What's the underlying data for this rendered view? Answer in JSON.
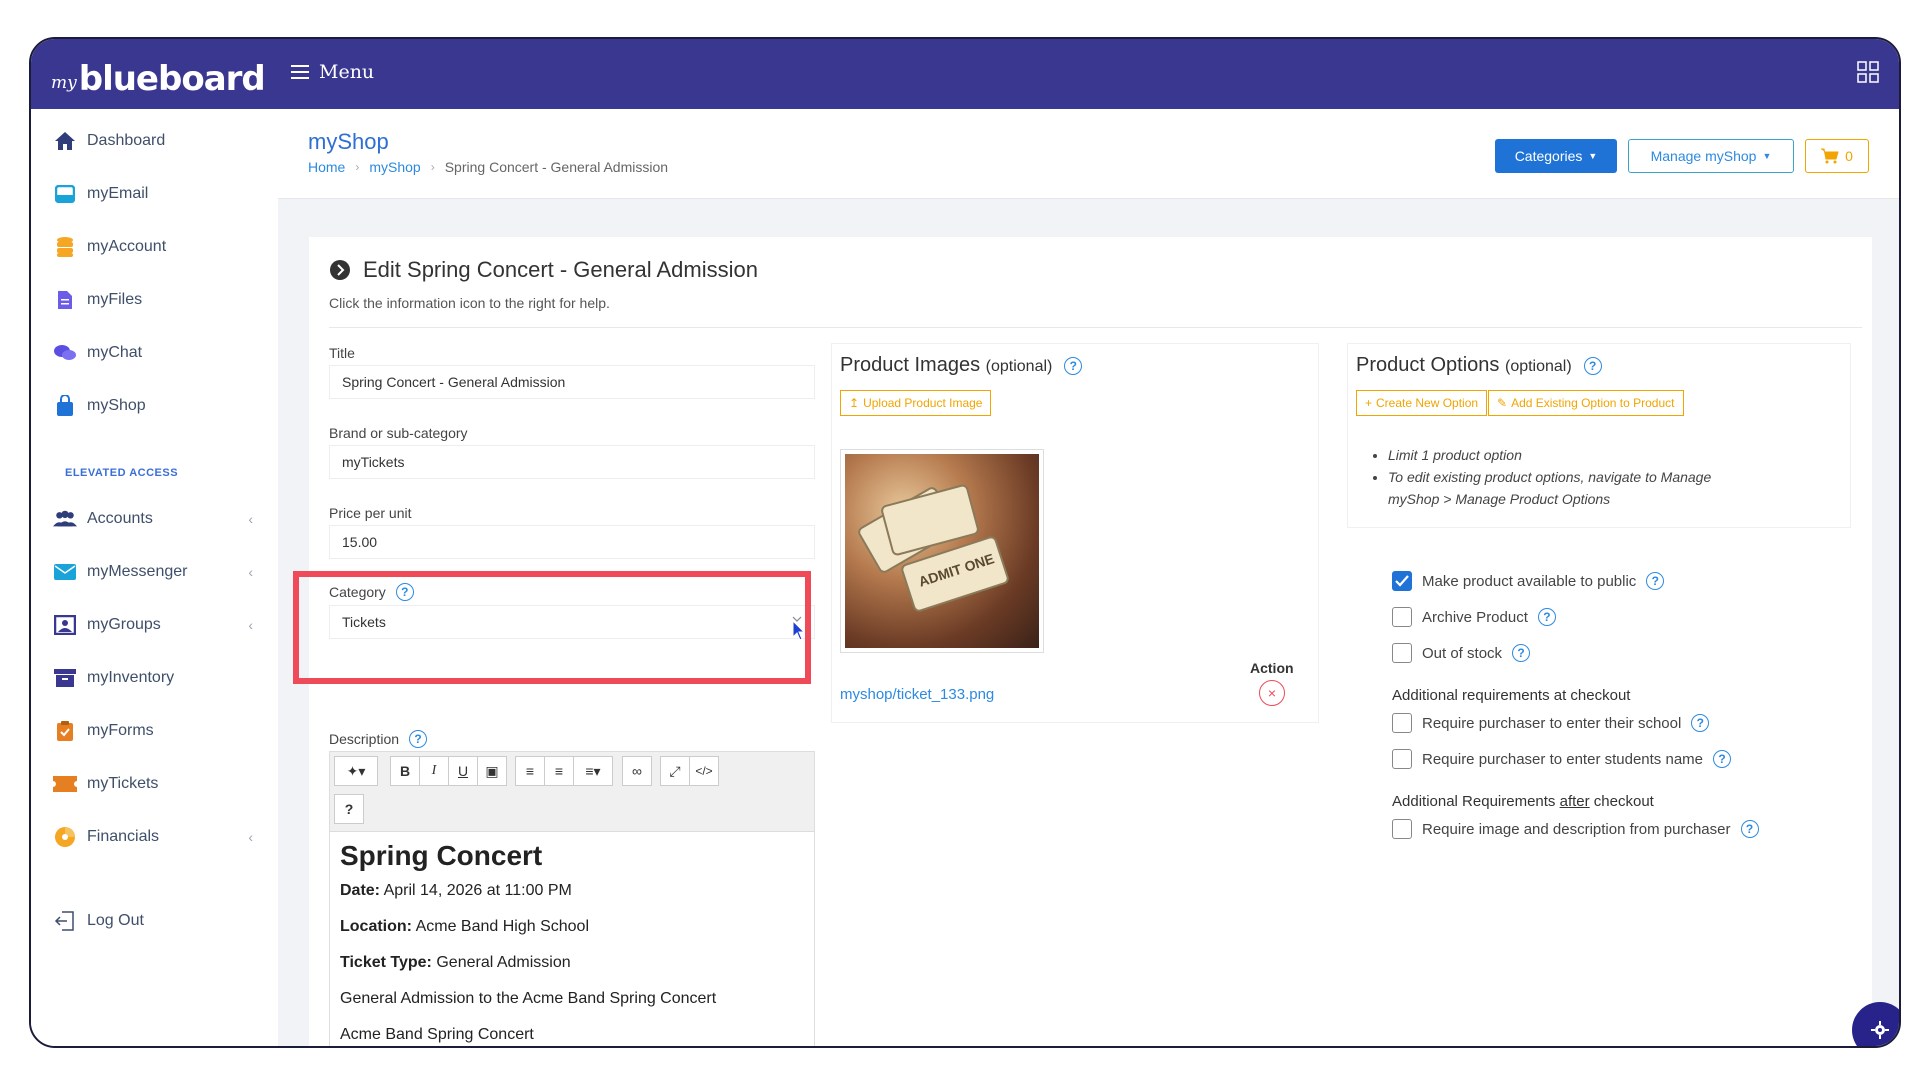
{
  "app": {
    "logo_prefix": "my",
    "logo_main": "blueboard",
    "menu_label": "Menu"
  },
  "sidebar": {
    "items": [
      {
        "label": "Dashboard",
        "icon": "home-icon",
        "color": "#2f3e7a"
      },
      {
        "label": "myEmail",
        "icon": "inbox-icon",
        "color": "#1aa3d9"
      },
      {
        "label": "myAccount",
        "icon": "database-icon",
        "color": "#f5a623"
      },
      {
        "label": "myFiles",
        "icon": "file-icon",
        "color": "#6c5ce7"
      },
      {
        "label": "myChat",
        "icon": "chat-icon",
        "color": "#5b4fe3"
      },
      {
        "label": "myShop",
        "icon": "shopping-bag-icon",
        "color": "#1f73d7"
      }
    ],
    "section_label": "ELEVATED ACCESS",
    "elevated_items": [
      {
        "label": "Accounts",
        "icon": "users-icon",
        "color": "#2f3e7a"
      },
      {
        "label": "myMessenger",
        "icon": "envelope-icon",
        "color": "#1aa3d9"
      },
      {
        "label": "myGroups",
        "icon": "groups-icon",
        "color": "#3a3790"
      },
      {
        "label": "myInventory",
        "icon": "archive-icon",
        "color": "#3a3790"
      },
      {
        "label": "myForms",
        "icon": "clipboard-icon",
        "color": "#e67e22"
      },
      {
        "label": "myTickets",
        "icon": "ticket-icon",
        "color": "#e67e22"
      },
      {
        "label": "Financials",
        "icon": "pie-chart-icon",
        "color": "#f5a623"
      }
    ],
    "logout_label": "Log Out"
  },
  "header": {
    "title": "myShop",
    "breadcrumb": [
      "Home",
      "myShop",
      "Spring Concert - General Admission"
    ],
    "categories_button": "Categories",
    "manage_button": "Manage myShop",
    "cart_count": "0"
  },
  "form": {
    "heading": "Edit Spring Concert - General Admission",
    "subheading": "Click the information icon to the right for help.",
    "title_label": "Title",
    "title_value": "Spring Concert - General Admission",
    "brand_label": "Brand or sub-category",
    "brand_value": "myTickets",
    "price_label": "Price per unit",
    "price_value": "15.00",
    "category_label": "Category",
    "category_value": "Tickets",
    "description_label": "Description",
    "toolbar": {
      "bold": "B",
      "italic": "I",
      "underline": "U",
      "help": "?",
      "code": "</>"
    },
    "description": {
      "heading": "Spring Concert",
      "date_label": "Date:",
      "date_value": "April 14, 2026 at 11:00 PM",
      "location_label": "Location:",
      "location_value": "Acme Band High School",
      "ticket_type_label": "Ticket Type:",
      "ticket_type_value": "General Admission",
      "line1": "General Admission to the Acme Band Spring Concert",
      "line2": "Acme Band Spring Concert"
    }
  },
  "images": {
    "title": "Product Images",
    "optional": "(optional)",
    "upload_button": "Upload Product Image",
    "image_text": "ADMIT ONE",
    "action_label": "Action",
    "file_name": "myshop/ticket_133.png"
  },
  "options": {
    "title": "Product Options",
    "optional": "(optional)",
    "create_button": "Create New Option",
    "add_existing_button": "Add Existing Option to Product",
    "notes": [
      "Limit 1 product option",
      "To edit existing product options, navigate to Manage myShop > Manage Product Options"
    ],
    "checkboxes": [
      {
        "label": "Make product available to public",
        "checked": true
      },
      {
        "label": "Archive Product",
        "checked": false
      },
      {
        "label": "Out of stock",
        "checked": false
      }
    ],
    "checkout_heading": "Additional requirements at checkout",
    "checkout_items": [
      {
        "label": "Require purchaser to enter their school",
        "checked": false
      },
      {
        "label": "Require purchaser to enter students name",
        "checked": false
      }
    ],
    "after_heading_pre": "Additional Requirements",
    "after_heading_u": "after",
    "after_heading_post": "checkout",
    "after_items": [
      {
        "label": "Require image and description from purchaser",
        "checked": false
      }
    ]
  }
}
